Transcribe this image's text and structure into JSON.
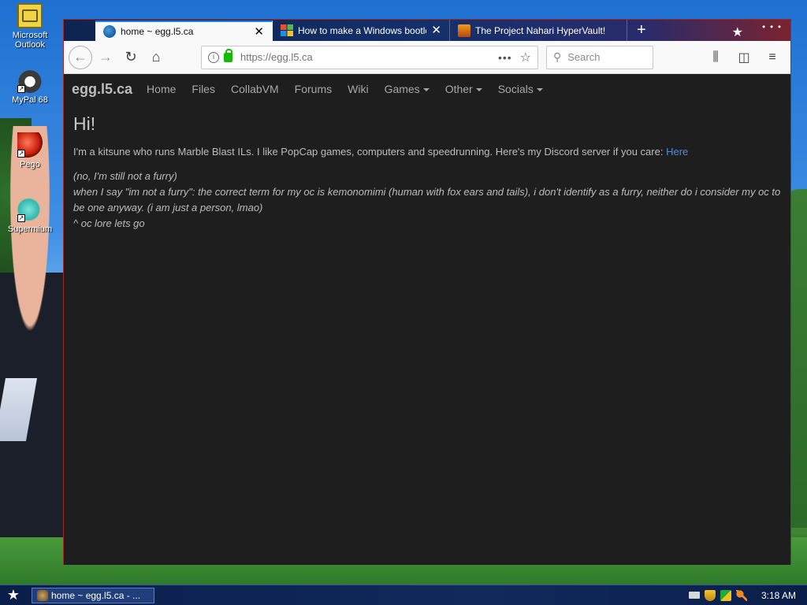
{
  "desktop": {
    "icons": [
      {
        "label": "Microsoft Outlook",
        "icon": "outlook-icon"
      },
      {
        "label": "MyPal 68",
        "icon": "mypal-icon"
      },
      {
        "label": "Pego",
        "icon": "pego-icon"
      },
      {
        "label": "Supermium",
        "icon": "supermium-icon"
      }
    ]
  },
  "browser": {
    "tabs": [
      {
        "title": "home ~ egg.l5.ca",
        "icon": "globe-icon",
        "active": true
      },
      {
        "title": "How to make a Windows bootleg/\\",
        "icon": "windows-logo-icon",
        "active": false
      },
      {
        "title": "The Project Nahari HyperVault!",
        "icon": "nahari-icon",
        "active": false
      }
    ],
    "new_tab": "+",
    "url": "https://egg.l5.ca",
    "page_actions": "•••",
    "search_placeholder": "Search"
  },
  "site": {
    "brand": "egg.l5.ca",
    "nav": [
      {
        "label": "Home",
        "dropdown": false
      },
      {
        "label": "Files",
        "dropdown": false
      },
      {
        "label": "CollabVM",
        "dropdown": false
      },
      {
        "label": "Forums",
        "dropdown": false
      },
      {
        "label": "Wiki",
        "dropdown": false
      },
      {
        "label": "Games",
        "dropdown": true
      },
      {
        "label": "Other",
        "dropdown": true
      },
      {
        "label": "Socials",
        "dropdown": true
      }
    ],
    "heading": "Hi!",
    "intro": "I'm a kitsune who runs Marble Blast ILs. I like PopCap games, computers and speedrunning. Here's my Discord server if you care:",
    "intro_link": "Here",
    "lines": [
      "(no, I'm still not a furry)",
      "when I say \"im not a furry\": the correct term for my oc is kemonomimi (human with fox ears and tails), i don't identify as a furry, neither do i consider my oc to be one anyway. (i am just a person, lmao)",
      "^ oc lore lets go"
    ]
  },
  "taskbar": {
    "task_label": "home ~ egg.l5.ca - ...",
    "clock": "3:18 AM"
  },
  "colors": {
    "page_bg": "#1e1e1e",
    "link": "#4f8fd6",
    "tab_accent": "#0a84ff",
    "lock_green": "#12bc00"
  }
}
